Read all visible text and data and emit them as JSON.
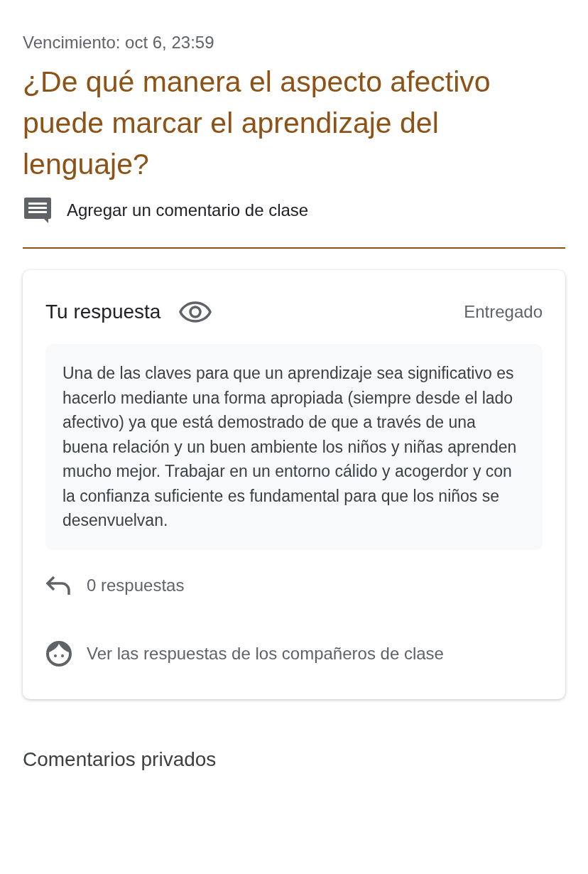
{
  "due": "Vencimiento: oct 6, 23:59",
  "title": "¿De qué manera el aspecto afectivo puede marcar el aprendizaje del lenguaje?",
  "class_comment": {
    "label": "Agregar un comentario de clase"
  },
  "response_card": {
    "heading": "Tu respuesta",
    "status": "Entregado",
    "answer": "Una de las claves para que un aprendizaje sea significativo es hacerlo mediante una forma apropiada (siempre desde el lado afectivo) ya que está demostrado de que a través de una buena relación y un buen ambiente los niños y niñas aprenden mucho mejor. Trabajar en un entorno cálido y acogerdor y con la confianza suficiente es fundamental para que los niños se desenvuelvan.",
    "replies": "0 respuestas",
    "classmates_link": "Ver las respuestas de los compañeros de clase"
  },
  "private_comments": {
    "heading": "Comentarios privados"
  }
}
